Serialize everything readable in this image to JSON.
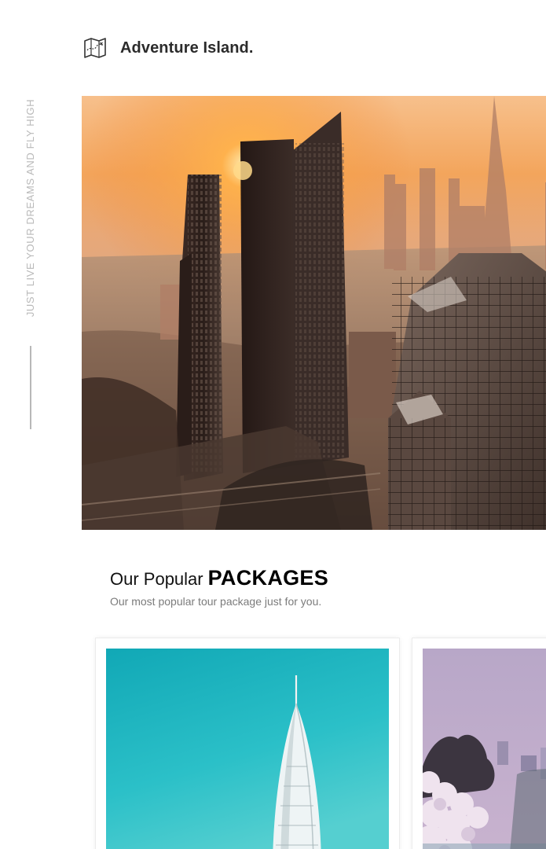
{
  "brand": {
    "name": "Adventure Island.",
    "icon": "map-icon"
  },
  "side": {
    "tagline": "JUST LIVE YOUR DREAMS AND FLY HIGH"
  },
  "hero": {
    "image": "city-skyline-sunset-photo"
  },
  "packages": {
    "title_prefix": "Our Popular",
    "title_main": "PACKAGES",
    "subtitle": "Our most popular tour package just for you.",
    "cards": [
      {
        "image": "burj-al-arab-tower-photo"
      },
      {
        "image": "cherry-blossom-park-photo"
      }
    ]
  },
  "colors": {
    "heading": "#111111",
    "muted": "#7b7b7b",
    "side_text": "#b9b9b9",
    "sky_teal": "#19b3bd",
    "sunset_orange": "#f08a3a"
  }
}
